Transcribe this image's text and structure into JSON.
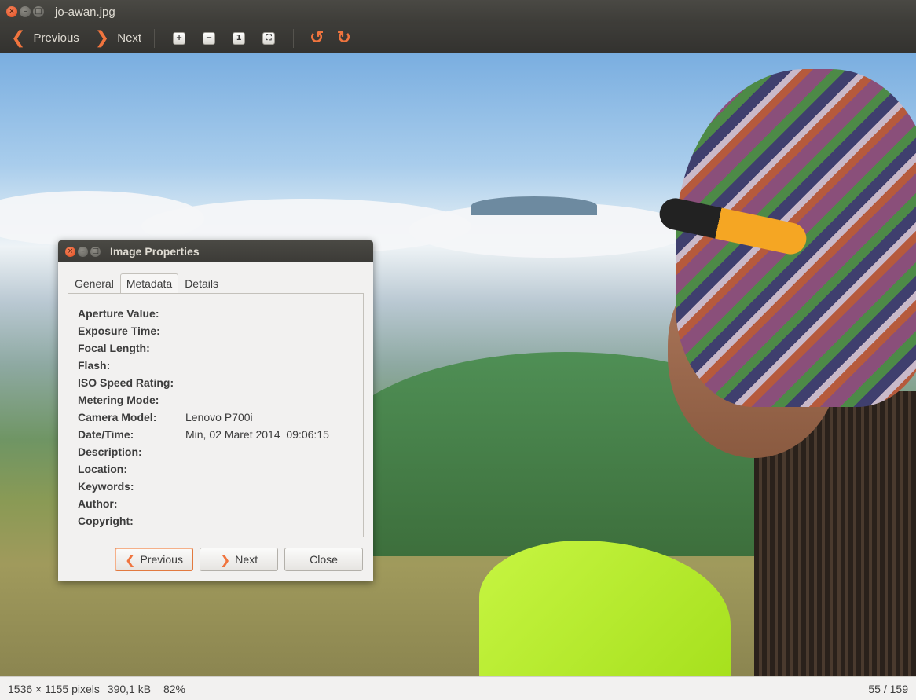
{
  "window": {
    "title": "jo-awan.jpg"
  },
  "toolbar": {
    "previous_label": "Previous",
    "next_label": "Next",
    "icons": [
      "zoom-in-icon",
      "zoom-out-icon",
      "zoom-normal-icon",
      "zoom-fit-icon",
      "rotate-left-icon",
      "rotate-right-icon"
    ]
  },
  "statusbar": {
    "dimensions": "1536 × 1155 pixels",
    "filesize": "390,1 kB",
    "zoom": "82%",
    "position": "55 / 159"
  },
  "dialog": {
    "title": "Image Properties",
    "tabs": [
      {
        "label": "General",
        "active": false
      },
      {
        "label": "Metadata",
        "active": true
      },
      {
        "label": "Details",
        "active": false
      }
    ],
    "metadata": [
      {
        "label": "Aperture Value:",
        "value": ""
      },
      {
        "label": "Exposure Time:",
        "value": ""
      },
      {
        "label": "Focal Length:",
        "value": ""
      },
      {
        "label": "Flash:",
        "value": ""
      },
      {
        "label": "ISO Speed Rating:",
        "value": ""
      },
      {
        "label": "Metering Mode:",
        "value": ""
      },
      {
        "label": "Camera Model:",
        "value": "Lenovo P700i"
      },
      {
        "label": "Date/Time:",
        "value": "Min, 02 Maret 2014  09:06:15"
      },
      {
        "label": "Description:",
        "value": ""
      },
      {
        "label": "Location:",
        "value": ""
      },
      {
        "label": "Keywords:",
        "value": ""
      },
      {
        "label": "Author:",
        "value": ""
      },
      {
        "label": "Copyright:",
        "value": ""
      }
    ],
    "buttons": {
      "previous": "Previous",
      "next": "Next",
      "close": "Close"
    }
  },
  "colors": {
    "accent": "#f0743e",
    "titlebar": "#3c3b37",
    "dialog_bg": "#f2f1f0"
  }
}
